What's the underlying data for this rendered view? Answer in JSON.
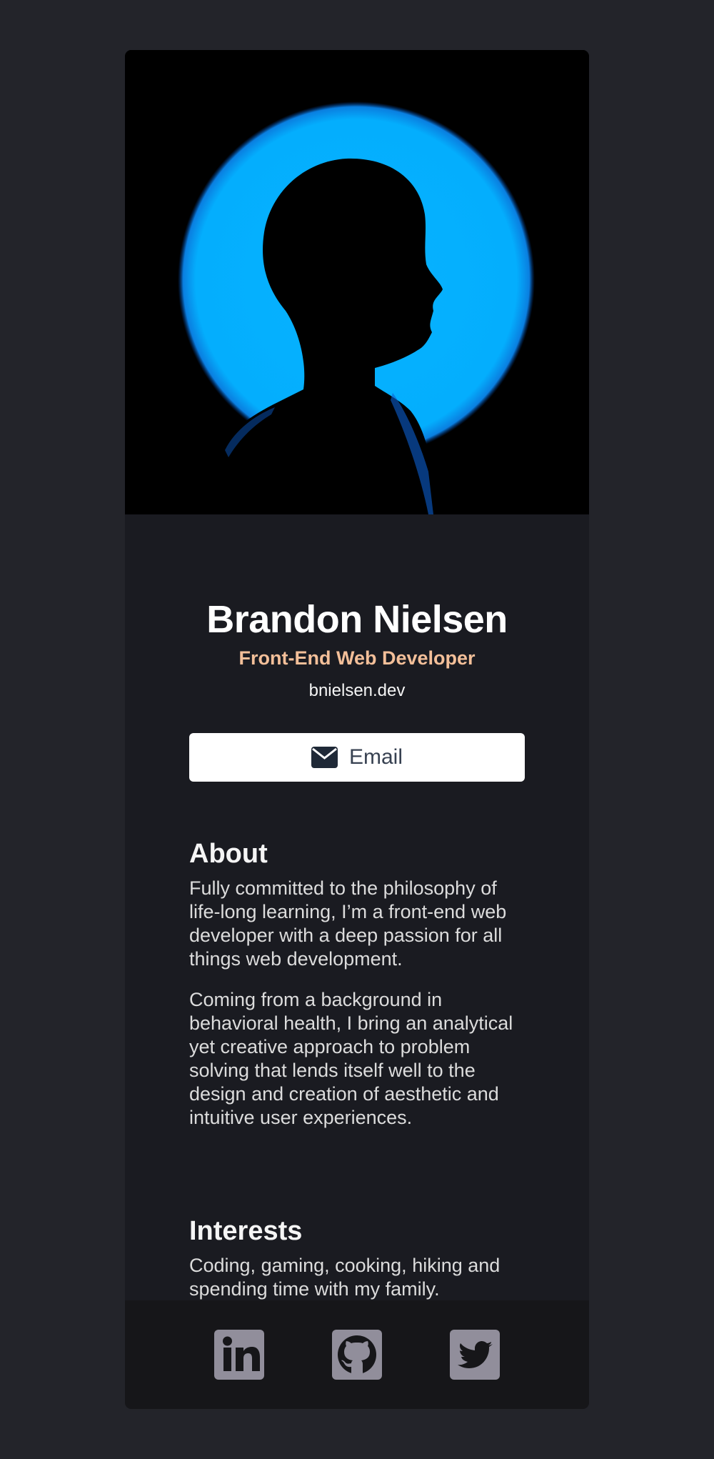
{
  "profile": {
    "name": "Brandon Nielsen",
    "role": "Front-End Web Developer",
    "website": "bnielsen.dev",
    "photo_icon": "silhouette-profile-photo"
  },
  "actions": {
    "email_label": "Email",
    "email_icon": "envelope-icon"
  },
  "about": {
    "heading": "About",
    "paragraphs": [
      "Fully committed to the philosophy of life-long learning, I’m a front-end web developer with a deep passion for all things web development.",
      "Coming from a background in behavioral health, I bring an analytical yet creative approach to problem solving that lends itself well to the design and creation of aesthetic and intuitive user experiences."
    ]
  },
  "interests": {
    "heading": "Interests",
    "text": "Coding, gaming, cooking, hiking and spending time with my family."
  },
  "footer": {
    "socials": [
      {
        "icon": "linkedin-icon"
      },
      {
        "icon": "github-icon"
      },
      {
        "icon": "twitter-icon"
      }
    ]
  },
  "colors": {
    "page_bg": "#23242a",
    "card_bg": "#1a1b21",
    "footer_bg": "#161619",
    "accent": "#f3bf99",
    "photo_glow": "#05b0ff",
    "social_icon_bg": "#918e9b"
  }
}
